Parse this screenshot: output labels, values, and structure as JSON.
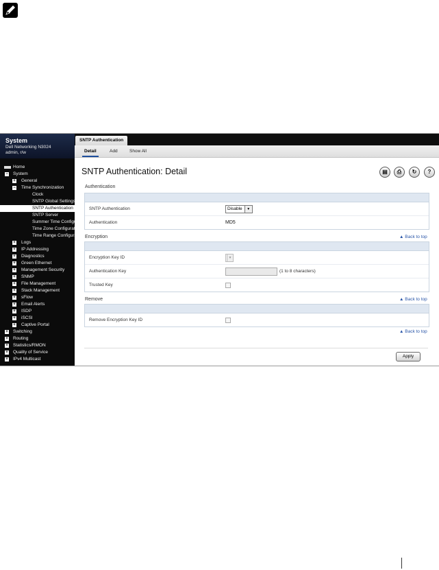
{
  "nav": {
    "header": {
      "title": "System",
      "model": "Dell Networking N3024",
      "user": "admin, r/w"
    },
    "items": [
      {
        "label": "Home",
        "level": 0,
        "box": "none"
      },
      {
        "label": "System",
        "level": 0,
        "box": "minus"
      },
      {
        "label": "General",
        "level": 1,
        "box": "plus"
      },
      {
        "label": "Time Synchronization",
        "level": 1,
        "box": "minus"
      },
      {
        "label": "Clock",
        "level": 2,
        "box": "none"
      },
      {
        "label": "SNTP Global Settings",
        "level": 2,
        "box": "none"
      },
      {
        "label": "SNTP Authentication",
        "level": 2,
        "box": "none",
        "selected": true
      },
      {
        "label": "SNTP Server",
        "level": 2,
        "box": "none"
      },
      {
        "label": "Summer Time Configuration",
        "level": 2,
        "box": "none"
      },
      {
        "label": "Time Zone Configuration",
        "level": 2,
        "box": "none"
      },
      {
        "label": "Time Range Configuration",
        "level": 2,
        "box": "none"
      },
      {
        "label": "Logs",
        "level": 1,
        "box": "plus"
      },
      {
        "label": "IP Addressing",
        "level": 1,
        "box": "plus"
      },
      {
        "label": "Diagnostics",
        "level": 1,
        "box": "plus"
      },
      {
        "label": "Green Ethernet",
        "level": 1,
        "box": "plus"
      },
      {
        "label": "Management Security",
        "level": 1,
        "box": "plus"
      },
      {
        "label": "SNMP",
        "level": 1,
        "box": "plus"
      },
      {
        "label": "File Management",
        "level": 1,
        "box": "plus"
      },
      {
        "label": "Stack Management",
        "level": 1,
        "box": "plus"
      },
      {
        "label": "sFlow",
        "level": 1,
        "box": "plus"
      },
      {
        "label": "Email Alerts",
        "level": 1,
        "box": "plus"
      },
      {
        "label": "ISDP",
        "level": 1,
        "box": "plus"
      },
      {
        "label": "iSCSI",
        "level": 1,
        "box": "plus"
      },
      {
        "label": "Captive Portal",
        "level": 1,
        "box": "plus"
      },
      {
        "label": "Switching",
        "level": 0,
        "box": "plus"
      },
      {
        "label": "Routing",
        "level": 0,
        "box": "plus"
      },
      {
        "label": "Statistics/RMON",
        "level": 0,
        "box": "plus"
      },
      {
        "label": "Quality of Service",
        "level": 0,
        "box": "plus"
      },
      {
        "label": "IPv4 Multicast",
        "level": 0,
        "box": "plus"
      }
    ]
  },
  "tabs": {
    "main": "SNTP Authentication",
    "sub": [
      "Detail",
      "Add",
      "Show All"
    ]
  },
  "page": {
    "title": "SNTP Authentication: Detail"
  },
  "toolbar": {
    "icons": [
      "save-icon",
      "print-icon",
      "refresh-icon",
      "help-icon"
    ]
  },
  "authentication": {
    "heading": "Authentication",
    "sntp_auth_label": "SNTP Authentication",
    "sntp_auth_value": "Disable",
    "auth_label": "Authentication",
    "auth_value": "MD5"
  },
  "encryption": {
    "heading": "Encryption",
    "back": "Back to top",
    "key_id_label": "Encryption Key ID",
    "auth_key_label": "Authentication Key",
    "auth_key_hint": "(1 to 8 characters)",
    "trusted_label": "Trusted Key"
  },
  "remove": {
    "heading": "Remove",
    "back": "Back to top",
    "remove_label": "Remove Encryption Key ID"
  },
  "footer": {
    "back": "Back to top",
    "apply": "Apply"
  },
  "colors": {
    "nav_bg": "#0b0b0b",
    "header_bg": "#1d2b49",
    "panel_bar": "#dfe7f1",
    "link": "#2a56a8"
  }
}
